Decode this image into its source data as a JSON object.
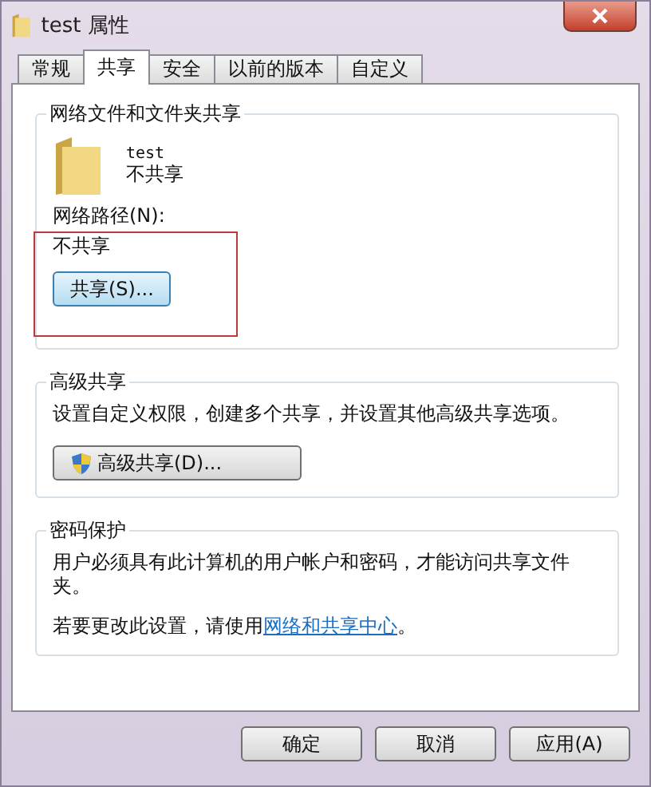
{
  "window": {
    "title": "test 属性"
  },
  "tabs": [
    {
      "label": "常规",
      "selected": false
    },
    {
      "label": "共享",
      "selected": true
    },
    {
      "label": "安全",
      "selected": false
    },
    {
      "label": "以前的版本",
      "selected": false
    },
    {
      "label": "自定义",
      "selected": false
    }
  ],
  "sharing": {
    "heading": "网络文件和文件夹共享",
    "folder_name": "test",
    "folder_status": "不共享",
    "path_label": "网络路径(N):",
    "path_value": "不共享",
    "share_button": "共享(S)..."
  },
  "advanced": {
    "heading": "高级共享",
    "description": "设置自定义权限，创建多个共享，并设置其他高级共享选项。",
    "button": "高级共享(D)..."
  },
  "password": {
    "heading": "密码保护",
    "description": "用户必须具有此计算机的用户帐户和密码，才能访问共享文件夹。",
    "prefix": "若要更改此设置，请使用",
    "link": "网络和共享中心",
    "suffix": "。"
  },
  "buttons": [
    "确定",
    "取消",
    "应用(A)"
  ]
}
